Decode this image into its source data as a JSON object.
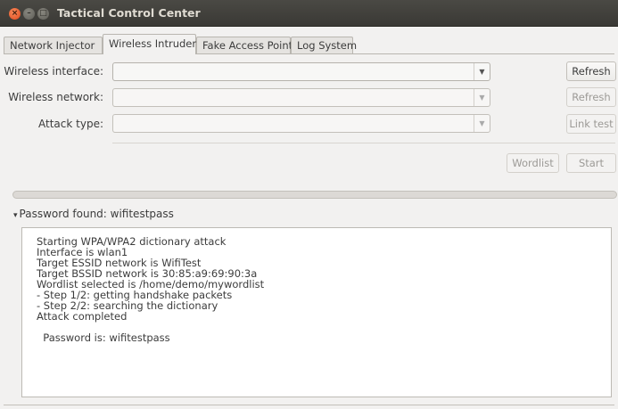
{
  "window": {
    "title": "Tactical Control Center",
    "close_glyph": "×",
    "min_glyph": "–",
    "max_glyph": "□"
  },
  "tabs": [
    {
      "label": "Network Injector"
    },
    {
      "label": "Wireless Intruder"
    },
    {
      "label": "Fake Access Point"
    },
    {
      "label": "Log System"
    }
  ],
  "active_tab": "Wireless Intruder",
  "form": {
    "interface_label": "Wireless interface:",
    "interface_value": "",
    "network_label": "Wireless network:",
    "network_value": "",
    "attack_label": "Attack type:",
    "attack_value": "",
    "dropdown_glyph": "▼"
  },
  "buttons": {
    "refresh_interface": "Refresh",
    "refresh_network": "Refresh",
    "link_test": "Link test",
    "wordlist": "Wordlist",
    "start": "Start"
  },
  "progress": {
    "value": 0
  },
  "expander": {
    "glyph": "▾",
    "label": "Password found: wifitestpass"
  },
  "log": {
    "lines": [
      "Starting WPA/WPA2 dictionary attack",
      "Interface is wlan1",
      "Target ESSID network is WifiTest",
      "Target BSSID network is 30:85:a9:69:90:3a",
      "Wordlist selected is /home/demo/mywordlist",
      "- Step 1/2: getting handshake packets",
      "- Step 2/2: searching the dictionary",
      "Attack completed",
      "",
      "  Password is: wifitestpass"
    ]
  },
  "colors": {
    "titlebar": "#3c3b37",
    "close_button": "#e1491d",
    "window_bg": "#f2f1f0"
  }
}
